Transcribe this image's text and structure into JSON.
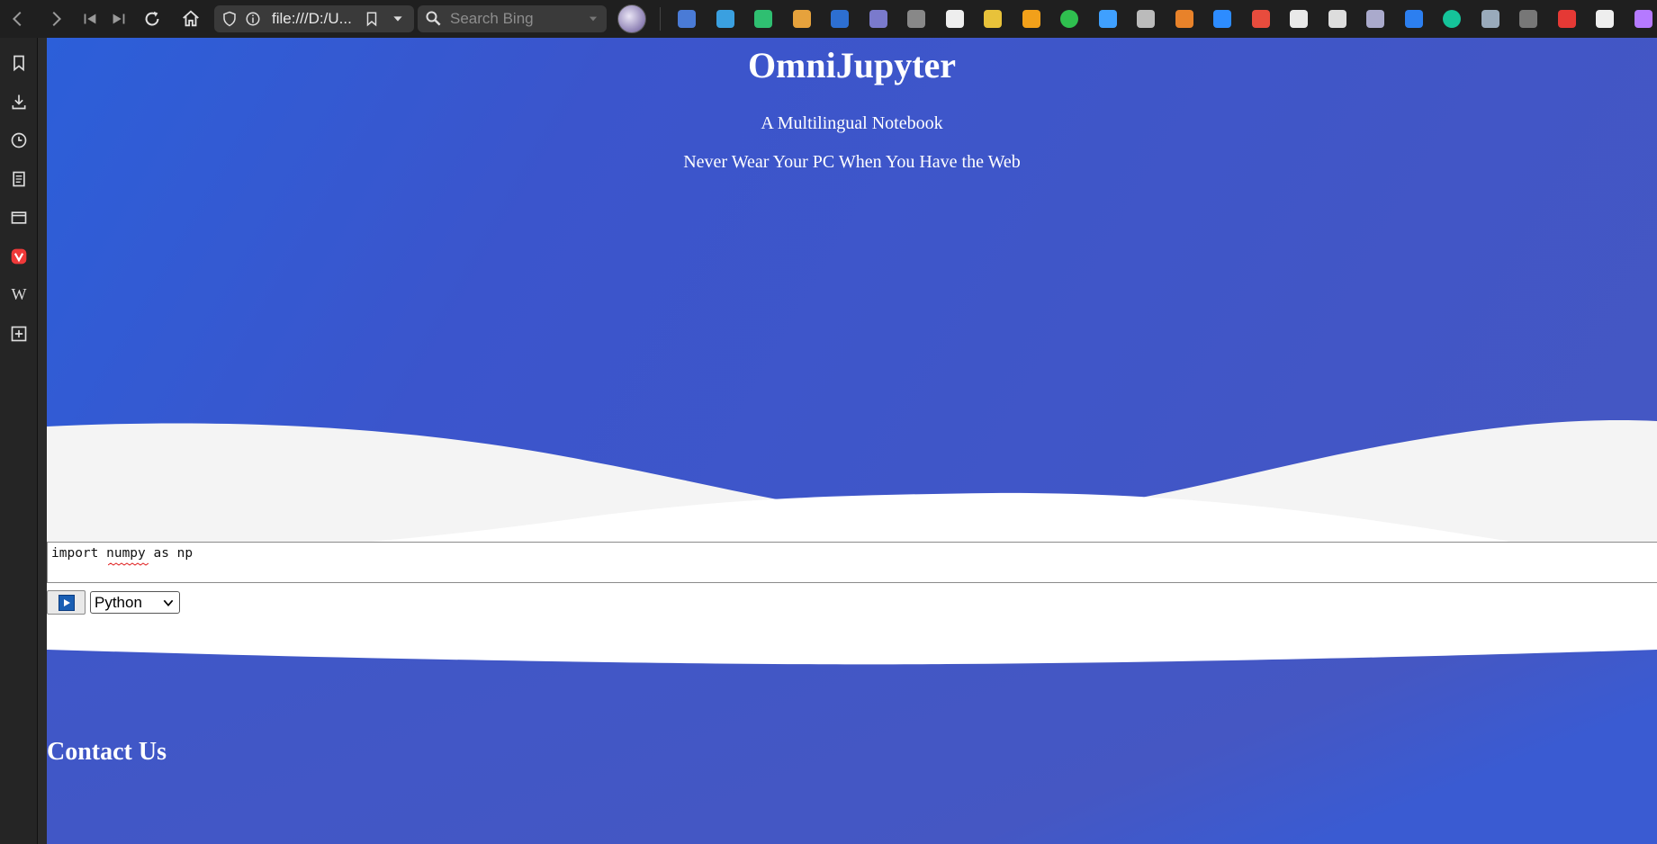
{
  "browser": {
    "address": "file:///D:/U...",
    "search_placeholder": "Search Bing"
  },
  "hero": {
    "title": "OmniJupyter",
    "subtitle": "A Multilingual Notebook",
    "tagline": "Never Wear Your PC When You Have the Web"
  },
  "notebook": {
    "code": "import numpy as np",
    "language": "Python",
    "language_options": [
      "Python"
    ]
  },
  "footer": {
    "heading": "Contact Us"
  },
  "colors": {
    "hero_blue": "#4557c3",
    "hero_blue_light": "#2c5fd9",
    "wave_gray": "#f4f4f4",
    "toolbar_bg": "#1f1f1f",
    "sidebar_bg": "#252525"
  },
  "extensions": [
    "google-translate-icon",
    "cloud-upload-icon",
    "save-page-icon",
    "color-picker-icon",
    "vpn-shield-icon",
    "cursor-icon",
    "cube-icon",
    "notion-icon",
    "highlighter-icon",
    "infinity-icon",
    "ghostery-icon",
    "diamond-icon",
    "chat-icon",
    "metamask-icon",
    "zoom-icon",
    "chart-icon",
    "mail-icon",
    "shield-check-icon",
    "react-icon",
    "dropbox-icon",
    "grammarly-icon",
    "eyedropper-icon",
    "recycle-icon",
    "hand-stop-icon",
    "list-icon",
    "gem-icon"
  ]
}
